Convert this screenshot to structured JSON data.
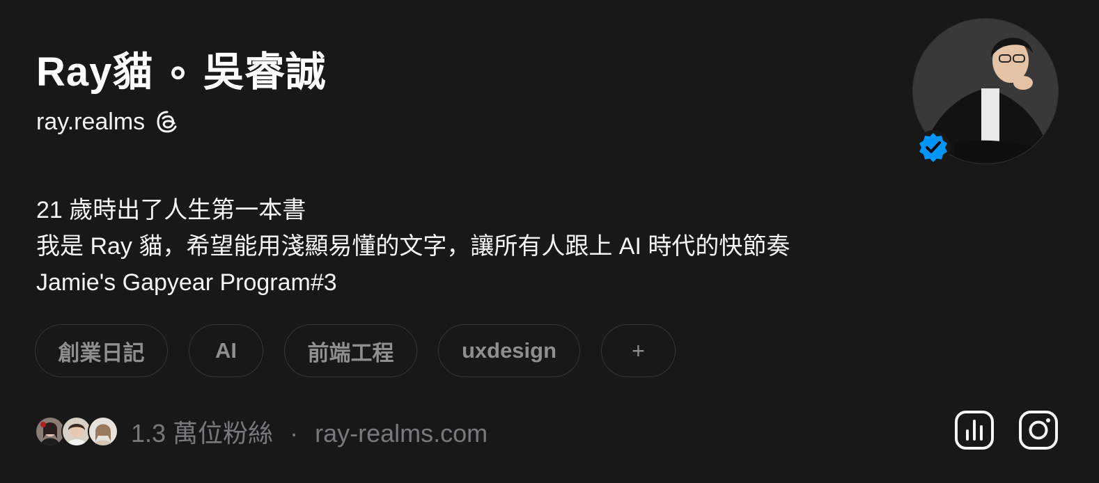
{
  "profile": {
    "display_name": "Ray貓 ∘ 吳睿誠",
    "handle": "ray.realms",
    "bio_lines": [
      "21 歲時出了人生第一本書",
      "我是 Ray 貓，希望能用淺顯易懂的文字，讓所有人跟上 AI 時代的快節奏",
      "Jamie's Gapyear Program#3"
    ],
    "verified": true
  },
  "tags": [
    {
      "label": "創業日記"
    },
    {
      "label": "AI"
    },
    {
      "label": "前端工程"
    },
    {
      "label": "uxdesign"
    },
    {
      "label": "+"
    }
  ],
  "footer": {
    "followers": "1.3 萬位粉絲",
    "separator": "·",
    "website": "ray-realms.com"
  },
  "icons": {
    "threads": "threads-icon",
    "verified": "verified-badge-icon",
    "insights": "insights-icon",
    "instagram": "instagram-icon"
  },
  "colors": {
    "background": "#181818",
    "verified": "#0095f6",
    "muted_text": "#777a7d",
    "tag_border": "#333638"
  }
}
